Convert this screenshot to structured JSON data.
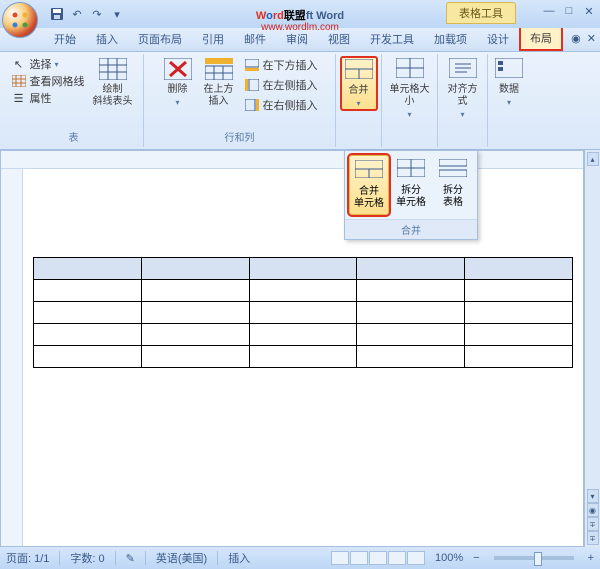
{
  "title": {
    "w": "W",
    "o": "o",
    "rd": "rd",
    "brand": "联盟",
    "suffix": "ft Word",
    "url": "www.wordlm.com"
  },
  "context_tab": "表格工具",
  "qat": {
    "save": "保存",
    "undo": "撤销",
    "redo": "重做"
  },
  "tabs": [
    "开始",
    "插入",
    "页面布局",
    "引用",
    "邮件",
    "审阅",
    "视图",
    "开发工具",
    "加载项",
    "设计",
    "布局"
  ],
  "ribbon": {
    "g1": {
      "select": "选择",
      "view_grid": "查看网格线",
      "props": "属性",
      "draw": "绘制\n斜线表头",
      "label": "表"
    },
    "g2": {
      "delete": "删除",
      "insert_above": "在上方\n插入",
      "below": "在下方插入",
      "left": "在左侧插入",
      "right": "在右侧插入",
      "label": "行和列"
    },
    "g3": {
      "merge": "合并",
      "label": ""
    },
    "g4": {
      "size": "单元格大小"
    },
    "g5": {
      "align": "对齐方式"
    },
    "g6": {
      "data": "数据"
    }
  },
  "dropdown": {
    "merge_cells": "合并\n单元格",
    "split_cells": "拆分\n单元格",
    "split_table": "拆分\n表格",
    "footer": "合并"
  },
  "status": {
    "page": "页面: 1/1",
    "words": "字数: 0",
    "lang": "英语(美国)",
    "mode": "插入",
    "zoom": "100%"
  }
}
